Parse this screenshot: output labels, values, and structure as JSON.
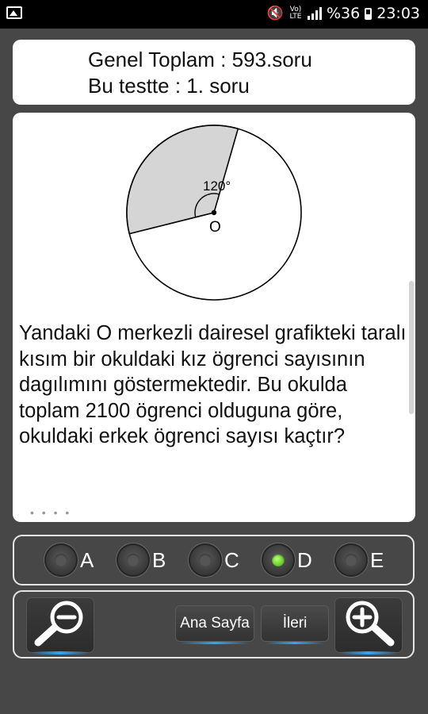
{
  "status_bar": {
    "battery_percent": "%36",
    "time": "23:03",
    "network_label": "Vo) LTE"
  },
  "header": {
    "total_line": "Genel Toplam : 593.soru",
    "test_line": "Bu testte : 1. soru"
  },
  "question": {
    "figure": {
      "angle_label": "120°",
      "center_label": "O",
      "shaded_degrees": 120
    },
    "text": "Yandaki O merkezli dairesel grafikteki taralı kısım bir okuldaki kız ögrenci sayısının dagılımını göstermektedir. Bu okulda toplam 2100 ögrenci olduguna göre, okuldaki erkek ögrenci sayısı kaçtır?"
  },
  "answers": {
    "options": [
      {
        "label": "A",
        "selected": false
      },
      {
        "label": "B",
        "selected": false
      },
      {
        "label": "C",
        "selected": false
      },
      {
        "label": "D",
        "selected": true
      },
      {
        "label": "E",
        "selected": false
      }
    ]
  },
  "toolbar": {
    "home_label": "Ana Sayfa",
    "next_label": "İleri",
    "zoom_out_icon": "zoom-out-icon",
    "zoom_in_icon": "zoom-in-icon"
  },
  "colors": {
    "background": "#474747",
    "card": "#ffffff",
    "selected_radio": "#5ec81e",
    "accent_glow": "#2aa8ff"
  }
}
